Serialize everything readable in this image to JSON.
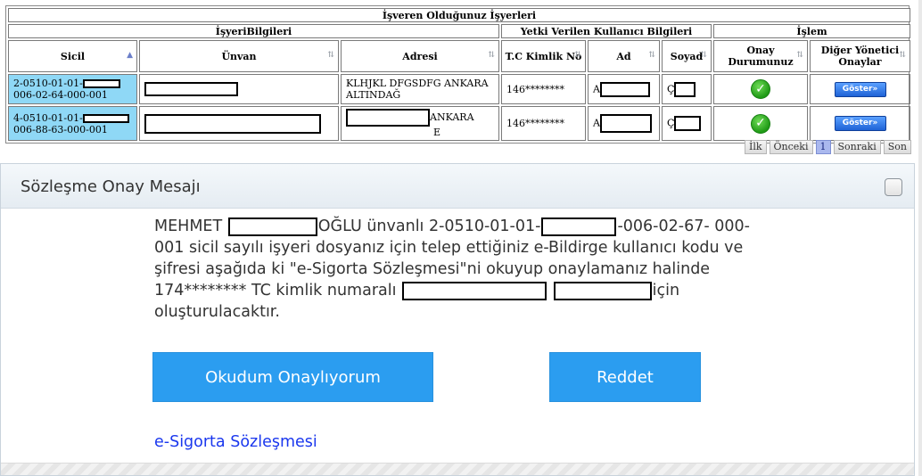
{
  "table": {
    "title": "İşveren Olduğunuz İşyerleri",
    "groups": {
      "isyeri": "İşyeriBilgileri",
      "yetki": "Yetki Verilen Kullanıcı Bilgileri",
      "islem": "İşlem"
    },
    "columns": {
      "sicil": "Sicil",
      "unvan": "Ünvan",
      "adresi": "Adresi",
      "tc": "T.C Kimlik No",
      "ad": "Ad",
      "soyad": "Soyad",
      "onay": "Onay Durumunuz",
      "diger": "Diğer Yönetici Onaylar"
    },
    "rows": [
      {
        "sicil_a": "2-0510-01-01-",
        "sicil_b": "006-02-64-000-001",
        "adres_a": "KLHJKL DFGSDFG ANKARA",
        "adres_b": "ALTINDAĞ",
        "tc": "146********",
        "ad_initial": "A",
        "soyad_initial": "Ç",
        "button": "Göster»"
      },
      {
        "sicil_a": "4-0510-01-01-",
        "sicil_b": "006-88-63-000-001",
        "adres_a": "ANKARA",
        "adres_b": "E",
        "tc": "146********",
        "ad_initial": "A",
        "soyad_initial": "Ç",
        "button": "Göster»"
      }
    ],
    "pager": {
      "first": "İlk",
      "prev": "Önceki",
      "page": "1",
      "next": "Sonraki",
      "last": "Son"
    }
  },
  "dialog": {
    "title": "Sözleşme Onay Mesajı",
    "msg": {
      "p1": "MEHMET",
      "p2": "OĞLU ünvanlı 2-0510-01-01-",
      "p3": "-006-02-67-",
      "p4": "000-001 sicil sayılı işyeri dosyanız için telep ettiğiniz e-Bildirge kullanıcı kodu ve şifresi aşağıda ki \"e-Sigorta Sözleşmesi\"ni okuyup onaylamanız halinde 174******** TC kimlik numaralı",
      "p5": "için oluşturulacaktır."
    },
    "accept_label": "Okudum Onaylıyorum",
    "reject_label": "Reddet",
    "link_label": "e-Sigorta Sözleşmesi"
  },
  "icons": {
    "check": "check-circle-icon",
    "sort": "sort-arrow-icon",
    "close": "close-icon"
  },
  "colors": {
    "selected_cell": "#8fd8f6",
    "button_blue": "#2b9df0",
    "link": "#1a37ee"
  }
}
